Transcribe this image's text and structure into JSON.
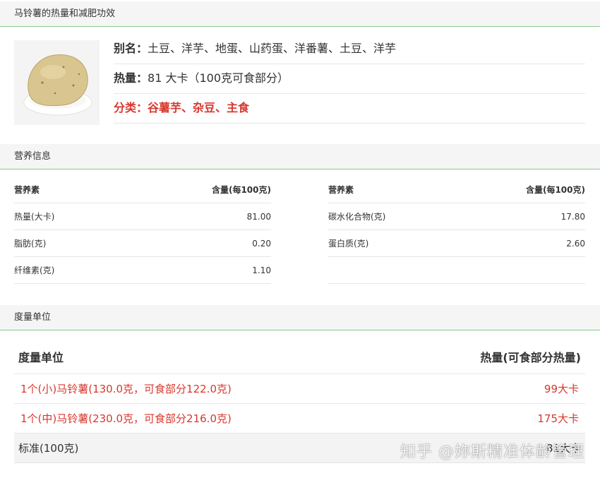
{
  "header": {
    "title": "马铃薯的热量和减肥功效"
  },
  "info": {
    "alias_label": "别名：",
    "alias_value": "土豆、洋芋、地蛋、山药蛋、洋番薯、土豆、洋芋",
    "calorie_label": "热量：",
    "calorie_value": "81 大卡（100克可食部分）",
    "category_label": "分类：",
    "category_value": "谷薯芋、杂豆、主食"
  },
  "nutrition": {
    "section_title": "营养信息",
    "col_name": "营养素",
    "col_value": "含量(每100克)",
    "left": [
      {
        "name": "热量(大卡)",
        "value": "81.00"
      },
      {
        "name": "脂肪(克)",
        "value": "0.20"
      },
      {
        "name": "纤维素(克)",
        "value": "1.10"
      }
    ],
    "right": [
      {
        "name": "碳水化合物(克)",
        "value": "17.80"
      },
      {
        "name": "蛋白质(克)",
        "value": "2.60"
      }
    ]
  },
  "units": {
    "section_title": "度量单位",
    "col_name": "度量单位",
    "col_value": "热量(可食部分热量)",
    "rows": [
      {
        "name": "1个(小)马铃薯(130.0克，可食部分122.0克)",
        "value": "99大卡"
      },
      {
        "name": "1个(中)马铃薯(230.0克，可食部分216.0克)",
        "value": "175大卡"
      },
      {
        "name": "标准(100克)",
        "value": "81大卡"
      }
    ]
  },
  "watermark": "知乎 @妳斯精准体龄管理",
  "colors": {
    "accent_green": "#8bc98b",
    "red": "#d9372d"
  }
}
